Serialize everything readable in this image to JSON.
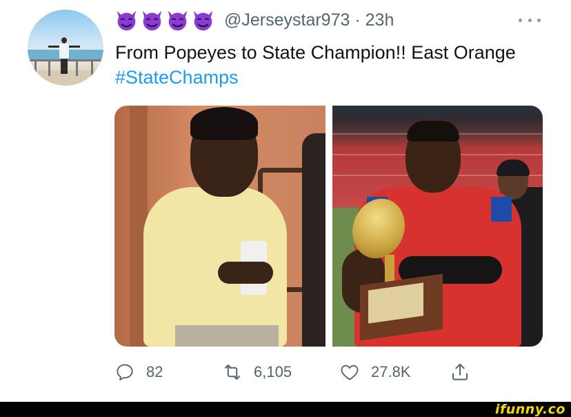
{
  "tweet": {
    "author_emoji": [
      "smiling-imp",
      "smiling-imp",
      "smiling-imp",
      "smiling-imp"
    ],
    "handle": "@Jerseystar973",
    "separator": "·",
    "time": "23h",
    "text_plain": "From Popeyes to State Champion!! East Orange ",
    "hashtag": "#StateChamps",
    "media": {
      "left_photo": "kid-in-yellow-shirt-holding-cup",
      "right_photo": "football-player-holding-trophy"
    },
    "actions": {
      "replies": "82",
      "retweets": "6,105",
      "likes": "27.8K"
    }
  },
  "colors": {
    "text": "#0f1419",
    "secondary": "#536471",
    "link": "#1d9bf0",
    "emoji_purple": "#8a3bd1"
  },
  "watermark": "ifunny.co"
}
